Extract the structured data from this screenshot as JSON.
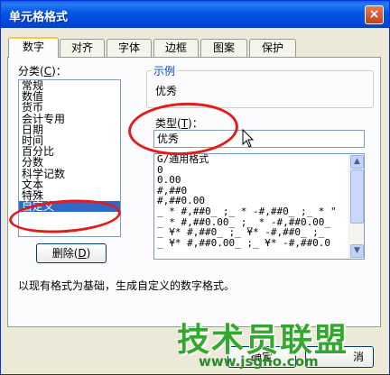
{
  "window": {
    "title": "单元格格式",
    "close_glyph": "×"
  },
  "tabs": [
    "数字",
    "对齐",
    "字体",
    "边框",
    "图案",
    "保护"
  ],
  "category": {
    "label_prefix": "分类(",
    "label_key": "C",
    "label_suffix": ")：",
    "items": [
      "常规",
      "数值",
      "货币",
      "会计专用",
      "日期",
      "时间",
      "百分比",
      "分数",
      "科学记数",
      "文本",
      "特殊",
      "自定义"
    ],
    "selected": "自定义"
  },
  "delete_button": {
    "prefix": "删除(",
    "key": "D",
    "suffix": ")"
  },
  "sample": {
    "title": "示例",
    "value": "优秀"
  },
  "type_field": {
    "label_prefix": "类型(",
    "label_key": "T",
    "label_suffix": ")：",
    "value": "优秀"
  },
  "format_list": [
    "G/通用格式",
    "0",
    "0.00",
    "#,##0",
    "#,##0.00",
    "_ * #,##0_ ;_ * -#,##0_ ;_ * \"",
    "_ * #,##0.00_ ;_ * -#,##0.00_",
    "_ ¥* #,##0_ ;_ ¥* -#,##0_ ;_",
    "_ ¥* #,##0.00_ ;_ ¥* -#,##0.0"
  ],
  "description": "以现有格式为基础，生成自定义的数字格式。",
  "bottom_buttons": {
    "ok_partial": "确定",
    "cancel_partial": "消"
  },
  "watermark": {
    "title": "技术员联盟",
    "url": "www.jsgho.com"
  },
  "colors": {
    "titlebar": "#0055E5",
    "annotation": "#E21B1B",
    "selection": "#316AC5",
    "watermark": "#32A82E"
  }
}
